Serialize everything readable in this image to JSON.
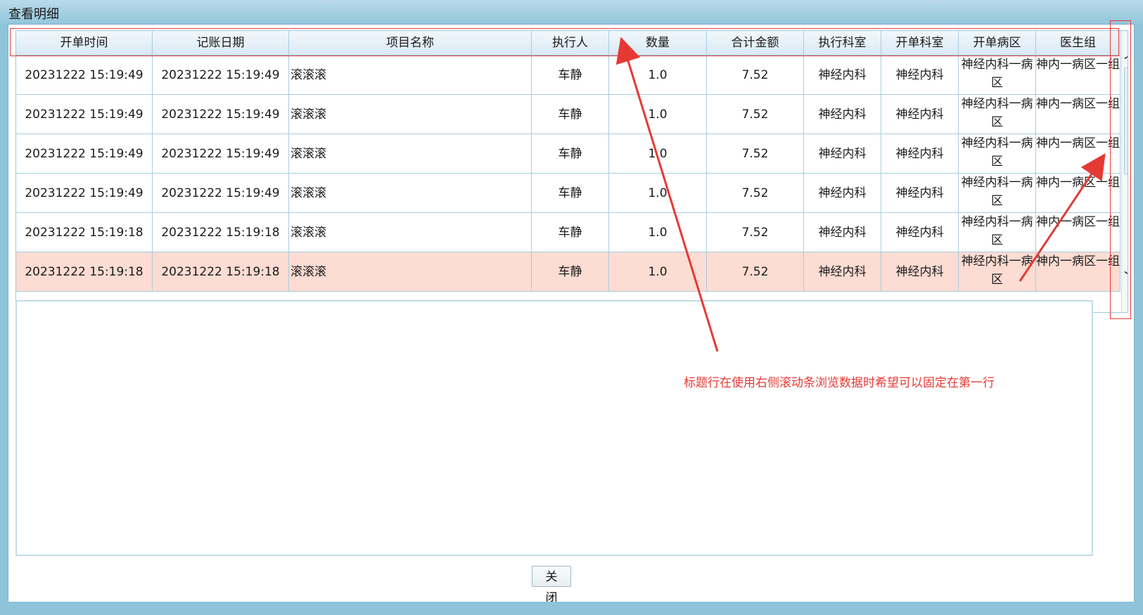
{
  "window": {
    "title": "查看明细"
  },
  "grid": {
    "columns": [
      "开单时间",
      "记账日期",
      "项目名称",
      "执行人",
      "数量",
      "合计金额",
      "执行科室",
      "开单科室",
      "开单病区",
      "医生组"
    ],
    "rows": [
      {
        "open_time": "20231222 15:19:49",
        "bill_date": "20231222 15:19:49",
        "item": "滚滚滚",
        "executor": "车静",
        "qty": "1.0",
        "amount": "7.52",
        "exec_dept": "神经内科",
        "open_dept": "神经内科",
        "ward": "神经内科一病区",
        "doctor_group": "神内一病区一组",
        "selected": false
      },
      {
        "open_time": "20231222 15:19:49",
        "bill_date": "20231222 15:19:49",
        "item": "滚滚滚",
        "executor": "车静",
        "qty": "1.0",
        "amount": "7.52",
        "exec_dept": "神经内科",
        "open_dept": "神经内科",
        "ward": "神经内科一病区",
        "doctor_group": "神内一病区一组",
        "selected": false
      },
      {
        "open_time": "20231222 15:19:49",
        "bill_date": "20231222 15:19:49",
        "item": "滚滚滚",
        "executor": "车静",
        "qty": "1.0",
        "amount": "7.52",
        "exec_dept": "神经内科",
        "open_dept": "神经内科",
        "ward": "神经内科一病区",
        "doctor_group": "神内一病区一组",
        "selected": false
      },
      {
        "open_time": "20231222 15:19:49",
        "bill_date": "20231222 15:19:49",
        "item": "滚滚滚",
        "executor": "车静",
        "qty": "1.0",
        "amount": "7.52",
        "exec_dept": "神经内科",
        "open_dept": "神经内科",
        "ward": "神经内科一病区",
        "doctor_group": "神内一病区一组",
        "selected": false
      },
      {
        "open_time": "20231222 15:19:18",
        "bill_date": "20231222 15:19:18",
        "item": "滚滚滚",
        "executor": "车静",
        "qty": "1.0",
        "amount": "7.52",
        "exec_dept": "神经内科",
        "open_dept": "神经内科",
        "ward": "神经内科一病区",
        "doctor_group": "神内一病区一组",
        "selected": false
      },
      {
        "open_time": "20231222 15:19:18",
        "bill_date": "20231222 15:19:18",
        "item": "滚滚滚",
        "executor": "车静",
        "qty": "1.0",
        "amount": "7.52",
        "exec_dept": "神经内科",
        "open_dept": "神经内科",
        "ward": "神经内科一病区",
        "doctor_group": "神内一病区一组",
        "selected": true
      }
    ]
  },
  "scrollbar": {
    "up_icon": "chevron-up-icon",
    "down_icon": "chevron-down-icon"
  },
  "footer": {
    "close_label": "关 闭"
  },
  "annotation": {
    "text": "标题行在使用右侧滚动条浏览数据时希望可以固定在第一行",
    "color": "#e53935"
  }
}
